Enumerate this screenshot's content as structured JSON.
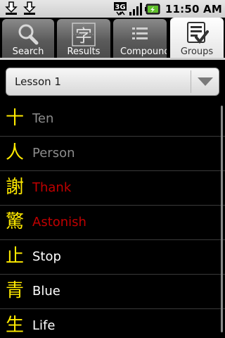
{
  "status_bar": {
    "time": "11:50 AM",
    "network": "3G",
    "icons": [
      "download-icon",
      "download-icon",
      "3g-icon",
      "signal-icon",
      "battery-charging-icon"
    ]
  },
  "tabs": [
    {
      "label": "Search",
      "icon": "search-icon",
      "active": false
    },
    {
      "label": "Results",
      "icon": "kanji-char-icon",
      "icon_glyph": "字",
      "active": false
    },
    {
      "label": "Compounds",
      "icon": "list-icon",
      "active": false
    },
    {
      "label": "Groups",
      "icon": "checklist-icon",
      "active": true
    }
  ],
  "group_select": {
    "value": "Lesson 1"
  },
  "colors": {
    "kanji": "#ffea00",
    "seen_gray": "#8c8c8c",
    "missed_red": "#c00000",
    "normal_white": "#ffffff",
    "active_tab": "#ffffff"
  },
  "items": [
    {
      "kanji": "十",
      "meaning": "Ten",
      "color": "#8c8c8c"
    },
    {
      "kanji": "人",
      "meaning": "Person",
      "color": "#8c8c8c"
    },
    {
      "kanji": "謝",
      "meaning": "Thank",
      "color": "#c00000"
    },
    {
      "kanji": "驚",
      "meaning": "Astonish",
      "color": "#c00000"
    },
    {
      "kanji": "止",
      "meaning": "Stop",
      "color": "#ffffff"
    },
    {
      "kanji": "青",
      "meaning": "Blue",
      "color": "#ffffff"
    },
    {
      "kanji": "生",
      "meaning": "Life",
      "color": "#ffffff"
    }
  ]
}
